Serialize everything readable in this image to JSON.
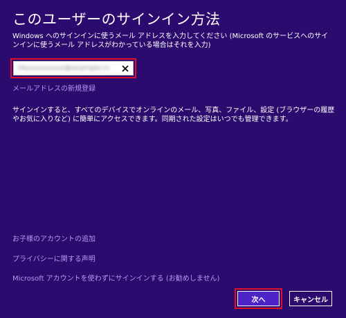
{
  "page": {
    "title": "このユーザーのサインイン方法",
    "description": "Windows へのサインインに使うメール アドレスを入力してください (Microsoft のサービスへのサインインに使うメール アドレスがわかっている場合はそれを入力)"
  },
  "email": {
    "value": "Hxxxxxxxxxx@example.com",
    "clear_icon": "close-icon"
  },
  "links": {
    "register": "メールアドレスの新規登録",
    "child_account": "お子様のアカウントの追加",
    "privacy": "プライバシーに関する声明",
    "local_account": "Microsoft アカウントを使わずにサインインする (お勧めしません)"
  },
  "info": {
    "text": "サインインすると、すべてのデバイスでオンラインのメール、写真、ファイル、設定 (ブラウザーの履歴やお気に入りなど) に簡単にアクセスできます。同期された設定はいつでも管理できます。"
  },
  "buttons": {
    "next": "次へ",
    "cancel": "キャンセル"
  },
  "colors": {
    "background": "#2b0b6e",
    "accent": "#4d24c6",
    "link": "#b39bf0",
    "highlight": "#e0102a"
  }
}
